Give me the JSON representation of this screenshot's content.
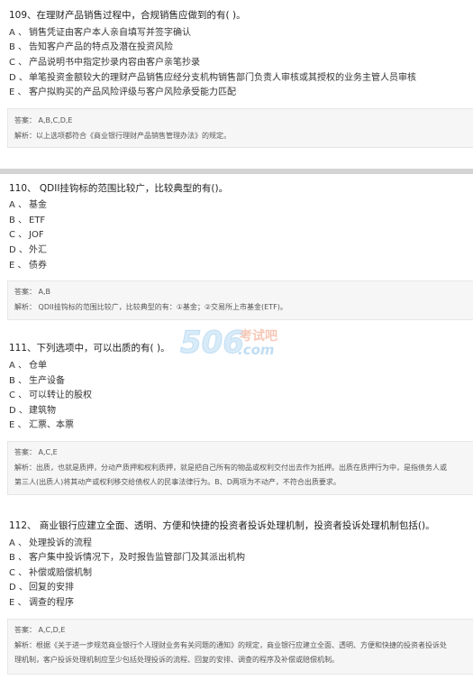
{
  "q109": {
    "title": "109、在理财产品销售过程中，合规销售应做到的有(       )。",
    "options": [
      {
        "letter": "A 、",
        "text": "销售凭证由客户本人亲自填写并签字确认"
      },
      {
        "letter": "B 、",
        "text": "告知客户产品的特点及潜在投资风险"
      },
      {
        "letter": "C 、",
        "text": "产品说明书中指定抄录内容由客户亲笔抄录"
      },
      {
        "letter": "D 、",
        "text": "单笔投资金额较大的理财产品销售应经分支机构销售部门负责人审核或其授权的业务主管人员审核"
      },
      {
        "letter": "E 、",
        "text": "客户拟购买的产品风险评级与客户风险承受能力匹配"
      }
    ],
    "answer": "答案： A,B,C,D,E",
    "analysis": "解析：以上选项都符合《商业银行理财产品销售管理办法》的规定。"
  },
  "q110": {
    "title": "110、 QDII挂钩标的范围比较广，比较典型的有()。",
    "options": [
      {
        "letter": "A 、",
        "text": "基金"
      },
      {
        "letter": "B 、",
        "text": "ETF"
      },
      {
        "letter": "C 、",
        "text": "JOF"
      },
      {
        "letter": "D 、",
        "text": "外汇"
      },
      {
        "letter": "E 、",
        "text": "债券"
      }
    ],
    "answer": "答案： A,B",
    "analysis": "解析： QDII挂钩标的范围比较广，比较典型的有：①基金；②交易所上市基金(ETF)。"
  },
  "q111": {
    "title": "111、下列选项中，可以出质的有(       )。",
    "options": [
      {
        "letter": "A 、",
        "text": "仓单"
      },
      {
        "letter": "B 、",
        "text": "生产设备"
      },
      {
        "letter": "C 、",
        "text": "可以转让的股权"
      },
      {
        "letter": "D 、",
        "text": "建筑物"
      },
      {
        "letter": "E 、",
        "text": "汇票、本票"
      }
    ],
    "answer": "答案： A,C,E",
    "analysis_lines": [
      "解析：出质，也就是质押，分动产质押和权利质押，就是把自己所有的物品或权利交付出去作为抵押。出质在质押行为中，是指债务人或",
      "第三人(出质人)将其动产或权利移交给债权人的民事法律行为。B、D两项为不动产，不符合出质要求。"
    ]
  },
  "q112": {
    "title": "112、 商业银行应建立全面、透明、方便和快捷的投资者投诉处理机制，投资者投诉处理机制包括()。",
    "options": [
      {
        "letter": "A 、",
        "text": "处理投诉的流程"
      },
      {
        "letter": "B 、",
        "text": "客户集中投诉情况下，及时报告监管部门及其派出机构"
      },
      {
        "letter": "C 、",
        "text": "补偿或赔偿机制"
      },
      {
        "letter": "D 、",
        "text": "回复的安排"
      },
      {
        "letter": "E 、",
        "text": "调查的程序"
      }
    ],
    "answer": "答案： A,C,D,E",
    "analysis_lines": [
      "解析：根据《关于进一步规范商业银行个人理财业务有关问题的通知》的规定，商业银行应建立全面、透明、方便和快捷的投资者投诉处",
      "理机制，客户投诉处理机制应至少包括处理投诉的流程、回复的安排、调查的程序及补偿或赔偿机制。"
    ]
  },
  "watermark": {
    "number": "506",
    "cn": "考试吧",
    "domain": ".com",
    "color": "#8fc3ea"
  }
}
